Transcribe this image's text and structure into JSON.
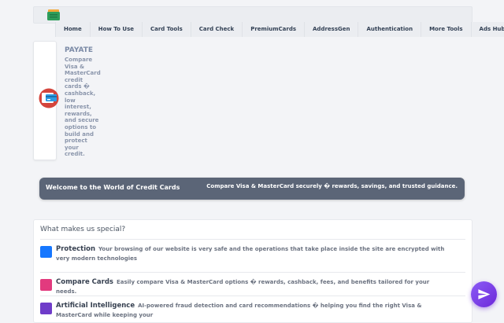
{
  "nav": {
    "items": [
      "Home",
      "How To Use",
      "Card Tools",
      "Card Check",
      "PremiumCards",
      "AddressGen",
      "Authentication",
      "More Tools",
      "Ads Hub"
    ]
  },
  "brand": {
    "title": "PAYATE",
    "description": "Compare Visa & MasterCard credit cards � cashback, low interest, rewards, and secure options to build and protect your credit."
  },
  "welcome": {
    "title": "Welcome to the World of Credit Cards",
    "subtitle": "Compare Visa & MasterCard securely � rewards, savings, and trusted guidance."
  },
  "special": {
    "title": "What makes us special?",
    "features": [
      {
        "name": "Protection",
        "text": "Your browsing of our website is very safe and the operations that take place inside the site are encrypted with very modern technologies",
        "color": "#1677ff"
      },
      {
        "name": "Compare Cards",
        "text": "Easily compare Visa & MasterCard options � rewards, cashback, fees, and benefits tailored for your needs.",
        "color": "#e23a7e"
      },
      {
        "name": "Artificial Intelligence",
        "text": "AI-powered fraud detection and card recommendations � helping you find the right Visa & MasterCard while keeping your",
        "color": "#6f3cc9"
      }
    ]
  },
  "icons": {
    "logo": "wallet-icon",
    "card": "credit-card-icon",
    "fab": "paper-plane-icon"
  }
}
